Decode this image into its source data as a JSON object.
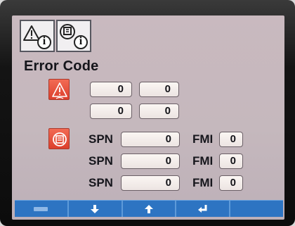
{
  "tabs": [
    {
      "name": "warning-info-tab",
      "icon": "warning-triangle-icon",
      "badge": "i"
    },
    {
      "name": "engine-info-tab",
      "icon": "engine-icon",
      "badge": "i"
    }
  ],
  "title": "Error Code",
  "warning_codes": {
    "icon": "warning-icon",
    "rows": [
      [
        "0",
        "0"
      ],
      [
        "0",
        "0"
      ]
    ]
  },
  "engine_codes": {
    "icon": "engine-icon",
    "rows": [
      {
        "spn_label": "SPN",
        "spn": "0",
        "fmi_label": "FMI",
        "fmi": "0"
      },
      {
        "spn_label": "SPN",
        "spn": "0",
        "fmi_label": "FMI",
        "fmi": "0"
      },
      {
        "spn_label": "SPN",
        "spn": "0",
        "fmi_label": "FMI",
        "fmi": "0"
      }
    ]
  },
  "softkeys": [
    {
      "name": "softkey-menu",
      "icon": "menu-icon"
    },
    {
      "name": "softkey-down",
      "icon": "arrow-down-icon"
    },
    {
      "name": "softkey-up",
      "icon": "arrow-up-icon"
    },
    {
      "name": "softkey-enter",
      "icon": "enter-icon"
    },
    {
      "name": "softkey-blank",
      "icon": ""
    }
  ],
  "colors": {
    "screen_bg": "#c5b8bd",
    "alert_icon": "#e24d37",
    "softkey_bar": "#2d74c2"
  }
}
